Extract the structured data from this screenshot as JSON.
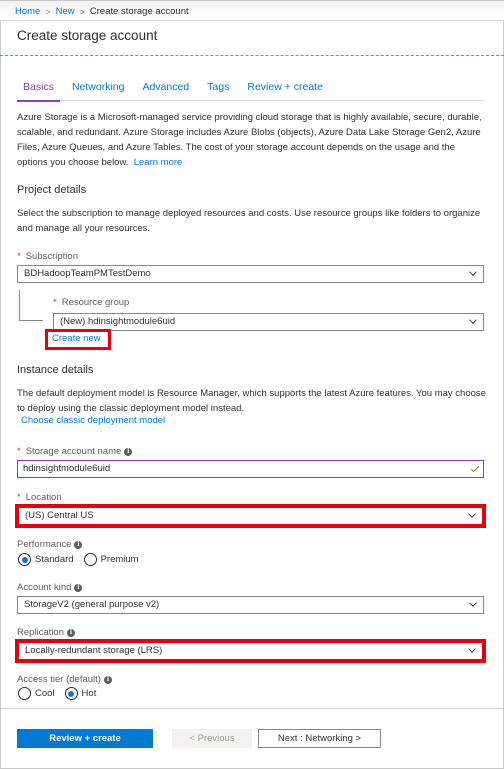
{
  "breadcrumb": {
    "items": [
      "Home",
      "New"
    ],
    "current": "Create storage account"
  },
  "page_title": "Create storage account",
  "tabs": [
    {
      "label": "Basics",
      "active": true
    },
    {
      "label": "Networking",
      "active": false
    },
    {
      "label": "Advanced",
      "active": false
    },
    {
      "label": "Tags",
      "active": false
    },
    {
      "label": "Review + create",
      "active": false
    }
  ],
  "intro": {
    "text": "Azure Storage is a Microsoft-managed service providing cloud storage that is highly available, secure, durable, scalable, and redundant. Azure Storage includes Azure Blobs (objects), Azure Data Lake Storage Gen2, Azure Files, Azure Queues, and Azure Tables. The cost of your storage account depends on the usage and the options you choose below.",
    "learn_more": "Learn more"
  },
  "project_details": {
    "heading": "Project details",
    "description": "Select the subscription to manage deployed resources and costs. Use resource groups like folders to organize and manage all your resources.",
    "subscription": {
      "label": "Subscription",
      "required": "*",
      "value": "BDHadoopTeamPMTestDemo"
    },
    "resource_group": {
      "label": "Resource group",
      "required": "*",
      "value": "(New) hdinsightmodule6uid",
      "create_new": "Create new"
    }
  },
  "instance_details": {
    "heading": "Instance details",
    "description": "The default deployment model is Resource Manager, which supports the latest Azure features. You may choose to deploy using the classic deployment model instead.",
    "classic_link": "Choose classic deployment model",
    "storage_account_name": {
      "label": "Storage account name",
      "required": "*",
      "value": "hdinsightmodule6uid"
    },
    "location": {
      "label": "Location",
      "required": "*",
      "value": "(US) Central US"
    },
    "performance": {
      "label": "Performance",
      "options": [
        "Standard",
        "Premium"
      ],
      "selected": "Standard"
    },
    "account_kind": {
      "label": "Account kind",
      "value": "StorageV2 (general purpose v2)"
    },
    "replication": {
      "label": "Replication",
      "value": "Locally-redundant storage (LRS)"
    },
    "access_tier": {
      "label": "Access tier (default)",
      "options": [
        "Cool",
        "Hot"
      ],
      "selected": "Hot"
    }
  },
  "footer": {
    "review_create": "Review + create",
    "previous": "< Previous",
    "next": "Next : Networking >"
  },
  "icons": {
    "info_glyph": "i",
    "breadcrumb_separator": ">"
  },
  "colors": {
    "accent": "#0078d4",
    "active_tab": "#8a3fb2",
    "required": "#d13438",
    "highlight": "#e3000f",
    "valid": "#57a300"
  }
}
